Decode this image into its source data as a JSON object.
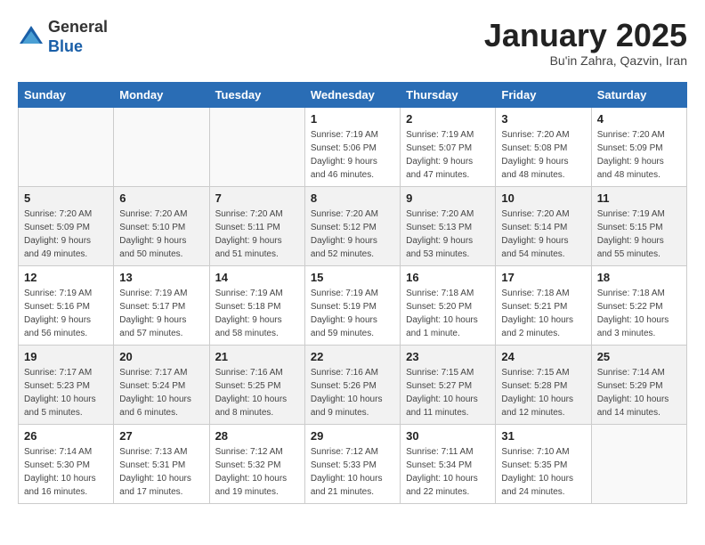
{
  "header": {
    "logo_line1": "General",
    "logo_line2": "Blue",
    "month_title": "January 2025",
    "subtitle": "Bu'in Zahra, Qazvin, Iran"
  },
  "weekdays": [
    "Sunday",
    "Monday",
    "Tuesday",
    "Wednesday",
    "Thursday",
    "Friday",
    "Saturday"
  ],
  "weeks": [
    [
      {
        "day": "",
        "info": ""
      },
      {
        "day": "",
        "info": ""
      },
      {
        "day": "",
        "info": ""
      },
      {
        "day": "1",
        "info": "Sunrise: 7:19 AM\nSunset: 5:06 PM\nDaylight: 9 hours\nand 46 minutes."
      },
      {
        "day": "2",
        "info": "Sunrise: 7:19 AM\nSunset: 5:07 PM\nDaylight: 9 hours\nand 47 minutes."
      },
      {
        "day": "3",
        "info": "Sunrise: 7:20 AM\nSunset: 5:08 PM\nDaylight: 9 hours\nand 48 minutes."
      },
      {
        "day": "4",
        "info": "Sunrise: 7:20 AM\nSunset: 5:09 PM\nDaylight: 9 hours\nand 48 minutes."
      }
    ],
    [
      {
        "day": "5",
        "info": "Sunrise: 7:20 AM\nSunset: 5:09 PM\nDaylight: 9 hours\nand 49 minutes."
      },
      {
        "day": "6",
        "info": "Sunrise: 7:20 AM\nSunset: 5:10 PM\nDaylight: 9 hours\nand 50 minutes."
      },
      {
        "day": "7",
        "info": "Sunrise: 7:20 AM\nSunset: 5:11 PM\nDaylight: 9 hours\nand 51 minutes."
      },
      {
        "day": "8",
        "info": "Sunrise: 7:20 AM\nSunset: 5:12 PM\nDaylight: 9 hours\nand 52 minutes."
      },
      {
        "day": "9",
        "info": "Sunrise: 7:20 AM\nSunset: 5:13 PM\nDaylight: 9 hours\nand 53 minutes."
      },
      {
        "day": "10",
        "info": "Sunrise: 7:20 AM\nSunset: 5:14 PM\nDaylight: 9 hours\nand 54 minutes."
      },
      {
        "day": "11",
        "info": "Sunrise: 7:19 AM\nSunset: 5:15 PM\nDaylight: 9 hours\nand 55 minutes."
      }
    ],
    [
      {
        "day": "12",
        "info": "Sunrise: 7:19 AM\nSunset: 5:16 PM\nDaylight: 9 hours\nand 56 minutes."
      },
      {
        "day": "13",
        "info": "Sunrise: 7:19 AM\nSunset: 5:17 PM\nDaylight: 9 hours\nand 57 minutes."
      },
      {
        "day": "14",
        "info": "Sunrise: 7:19 AM\nSunset: 5:18 PM\nDaylight: 9 hours\nand 58 minutes."
      },
      {
        "day": "15",
        "info": "Sunrise: 7:19 AM\nSunset: 5:19 PM\nDaylight: 9 hours\nand 59 minutes."
      },
      {
        "day": "16",
        "info": "Sunrise: 7:18 AM\nSunset: 5:20 PM\nDaylight: 10 hours\nand 1 minute."
      },
      {
        "day": "17",
        "info": "Sunrise: 7:18 AM\nSunset: 5:21 PM\nDaylight: 10 hours\nand 2 minutes."
      },
      {
        "day": "18",
        "info": "Sunrise: 7:18 AM\nSunset: 5:22 PM\nDaylight: 10 hours\nand 3 minutes."
      }
    ],
    [
      {
        "day": "19",
        "info": "Sunrise: 7:17 AM\nSunset: 5:23 PM\nDaylight: 10 hours\nand 5 minutes."
      },
      {
        "day": "20",
        "info": "Sunrise: 7:17 AM\nSunset: 5:24 PM\nDaylight: 10 hours\nand 6 minutes."
      },
      {
        "day": "21",
        "info": "Sunrise: 7:16 AM\nSunset: 5:25 PM\nDaylight: 10 hours\nand 8 minutes."
      },
      {
        "day": "22",
        "info": "Sunrise: 7:16 AM\nSunset: 5:26 PM\nDaylight: 10 hours\nand 9 minutes."
      },
      {
        "day": "23",
        "info": "Sunrise: 7:15 AM\nSunset: 5:27 PM\nDaylight: 10 hours\nand 11 minutes."
      },
      {
        "day": "24",
        "info": "Sunrise: 7:15 AM\nSunset: 5:28 PM\nDaylight: 10 hours\nand 12 minutes."
      },
      {
        "day": "25",
        "info": "Sunrise: 7:14 AM\nSunset: 5:29 PM\nDaylight: 10 hours\nand 14 minutes."
      }
    ],
    [
      {
        "day": "26",
        "info": "Sunrise: 7:14 AM\nSunset: 5:30 PM\nDaylight: 10 hours\nand 16 minutes."
      },
      {
        "day": "27",
        "info": "Sunrise: 7:13 AM\nSunset: 5:31 PM\nDaylight: 10 hours\nand 17 minutes."
      },
      {
        "day": "28",
        "info": "Sunrise: 7:12 AM\nSunset: 5:32 PM\nDaylight: 10 hours\nand 19 minutes."
      },
      {
        "day": "29",
        "info": "Sunrise: 7:12 AM\nSunset: 5:33 PM\nDaylight: 10 hours\nand 21 minutes."
      },
      {
        "day": "30",
        "info": "Sunrise: 7:11 AM\nSunset: 5:34 PM\nDaylight: 10 hours\nand 22 minutes."
      },
      {
        "day": "31",
        "info": "Sunrise: 7:10 AM\nSunset: 5:35 PM\nDaylight: 10 hours\nand 24 minutes."
      },
      {
        "day": "",
        "info": ""
      }
    ]
  ]
}
